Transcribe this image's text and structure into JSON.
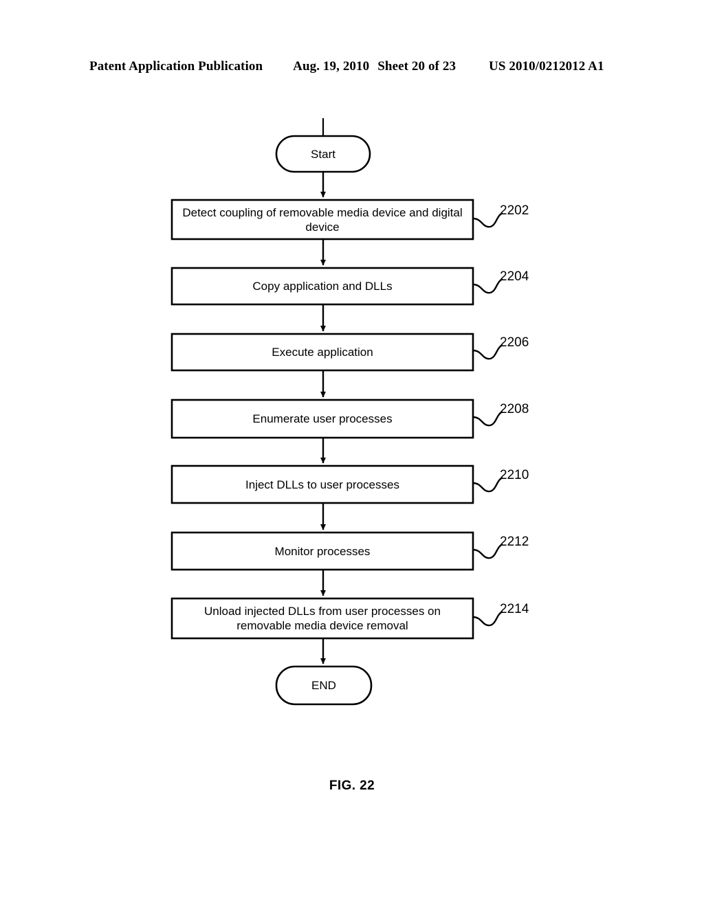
{
  "header": {
    "publication": "Patent Application Publication",
    "date": "Aug. 19, 2010",
    "sheet": "Sheet 20 of 23",
    "patent_number": "US 2010/0212012 A1"
  },
  "figure": {
    "caption": "FIG. 22"
  },
  "chart_data": {
    "type": "diagram",
    "diagram_type": "flowchart",
    "title": "FIG. 22",
    "orientation": "top-to-bottom",
    "nodes": [
      {
        "id": "start",
        "shape": "stadium",
        "label": "Start",
        "ref": null
      },
      {
        "id": "s2202",
        "shape": "rectangle",
        "label": "Detect coupling of removable media device and digital device",
        "ref": "2202"
      },
      {
        "id": "s2204",
        "shape": "rectangle",
        "label": "Copy application and DLLs",
        "ref": "2204"
      },
      {
        "id": "s2206",
        "shape": "rectangle",
        "label": "Execute application",
        "ref": "2206"
      },
      {
        "id": "s2208",
        "shape": "rectangle",
        "label": "Enumerate user processes",
        "ref": "2208"
      },
      {
        "id": "s2210",
        "shape": "rectangle",
        "label": "Inject DLLs to user processes",
        "ref": "2210"
      },
      {
        "id": "s2212",
        "shape": "rectangle",
        "label": "Monitor processes",
        "ref": "2212"
      },
      {
        "id": "s2214",
        "shape": "rectangle",
        "label": "Unload injected DLLs from user processes on removable media device removal",
        "ref": "2214"
      },
      {
        "id": "end",
        "shape": "stadium",
        "label": "END",
        "ref": null
      }
    ],
    "edges": [
      {
        "from": "entry",
        "to": "start",
        "arrow": false
      },
      {
        "from": "start",
        "to": "s2202",
        "arrow": true
      },
      {
        "from": "s2202",
        "to": "s2204",
        "arrow": true
      },
      {
        "from": "s2204",
        "to": "s2206",
        "arrow": true
      },
      {
        "from": "s2206",
        "to": "s2208",
        "arrow": true
      },
      {
        "from": "s2208",
        "to": "s2210",
        "arrow": true
      },
      {
        "from": "s2210",
        "to": "s2212",
        "arrow": true
      },
      {
        "from": "s2212",
        "to": "s2214",
        "arrow": true
      },
      {
        "from": "s2214",
        "to": "end",
        "arrow": true
      }
    ],
    "leader_lines": [
      {
        "ref": "2202",
        "from_node": "s2202",
        "style": "squiggle"
      },
      {
        "ref": "2204",
        "from_node": "s2204",
        "style": "squiggle"
      },
      {
        "ref": "2206",
        "from_node": "s2206",
        "style": "squiggle"
      },
      {
        "ref": "2208",
        "from_node": "s2208",
        "style": "squiggle"
      },
      {
        "ref": "2210",
        "from_node": "s2210",
        "style": "squiggle"
      },
      {
        "ref": "2212",
        "from_node": "s2212",
        "style": "squiggle"
      },
      {
        "ref": "2214",
        "from_node": "s2214",
        "style": "squiggle"
      }
    ],
    "colors": {
      "stroke": "#000000",
      "fill": "#ffffff",
      "background": "#ffffff"
    }
  }
}
